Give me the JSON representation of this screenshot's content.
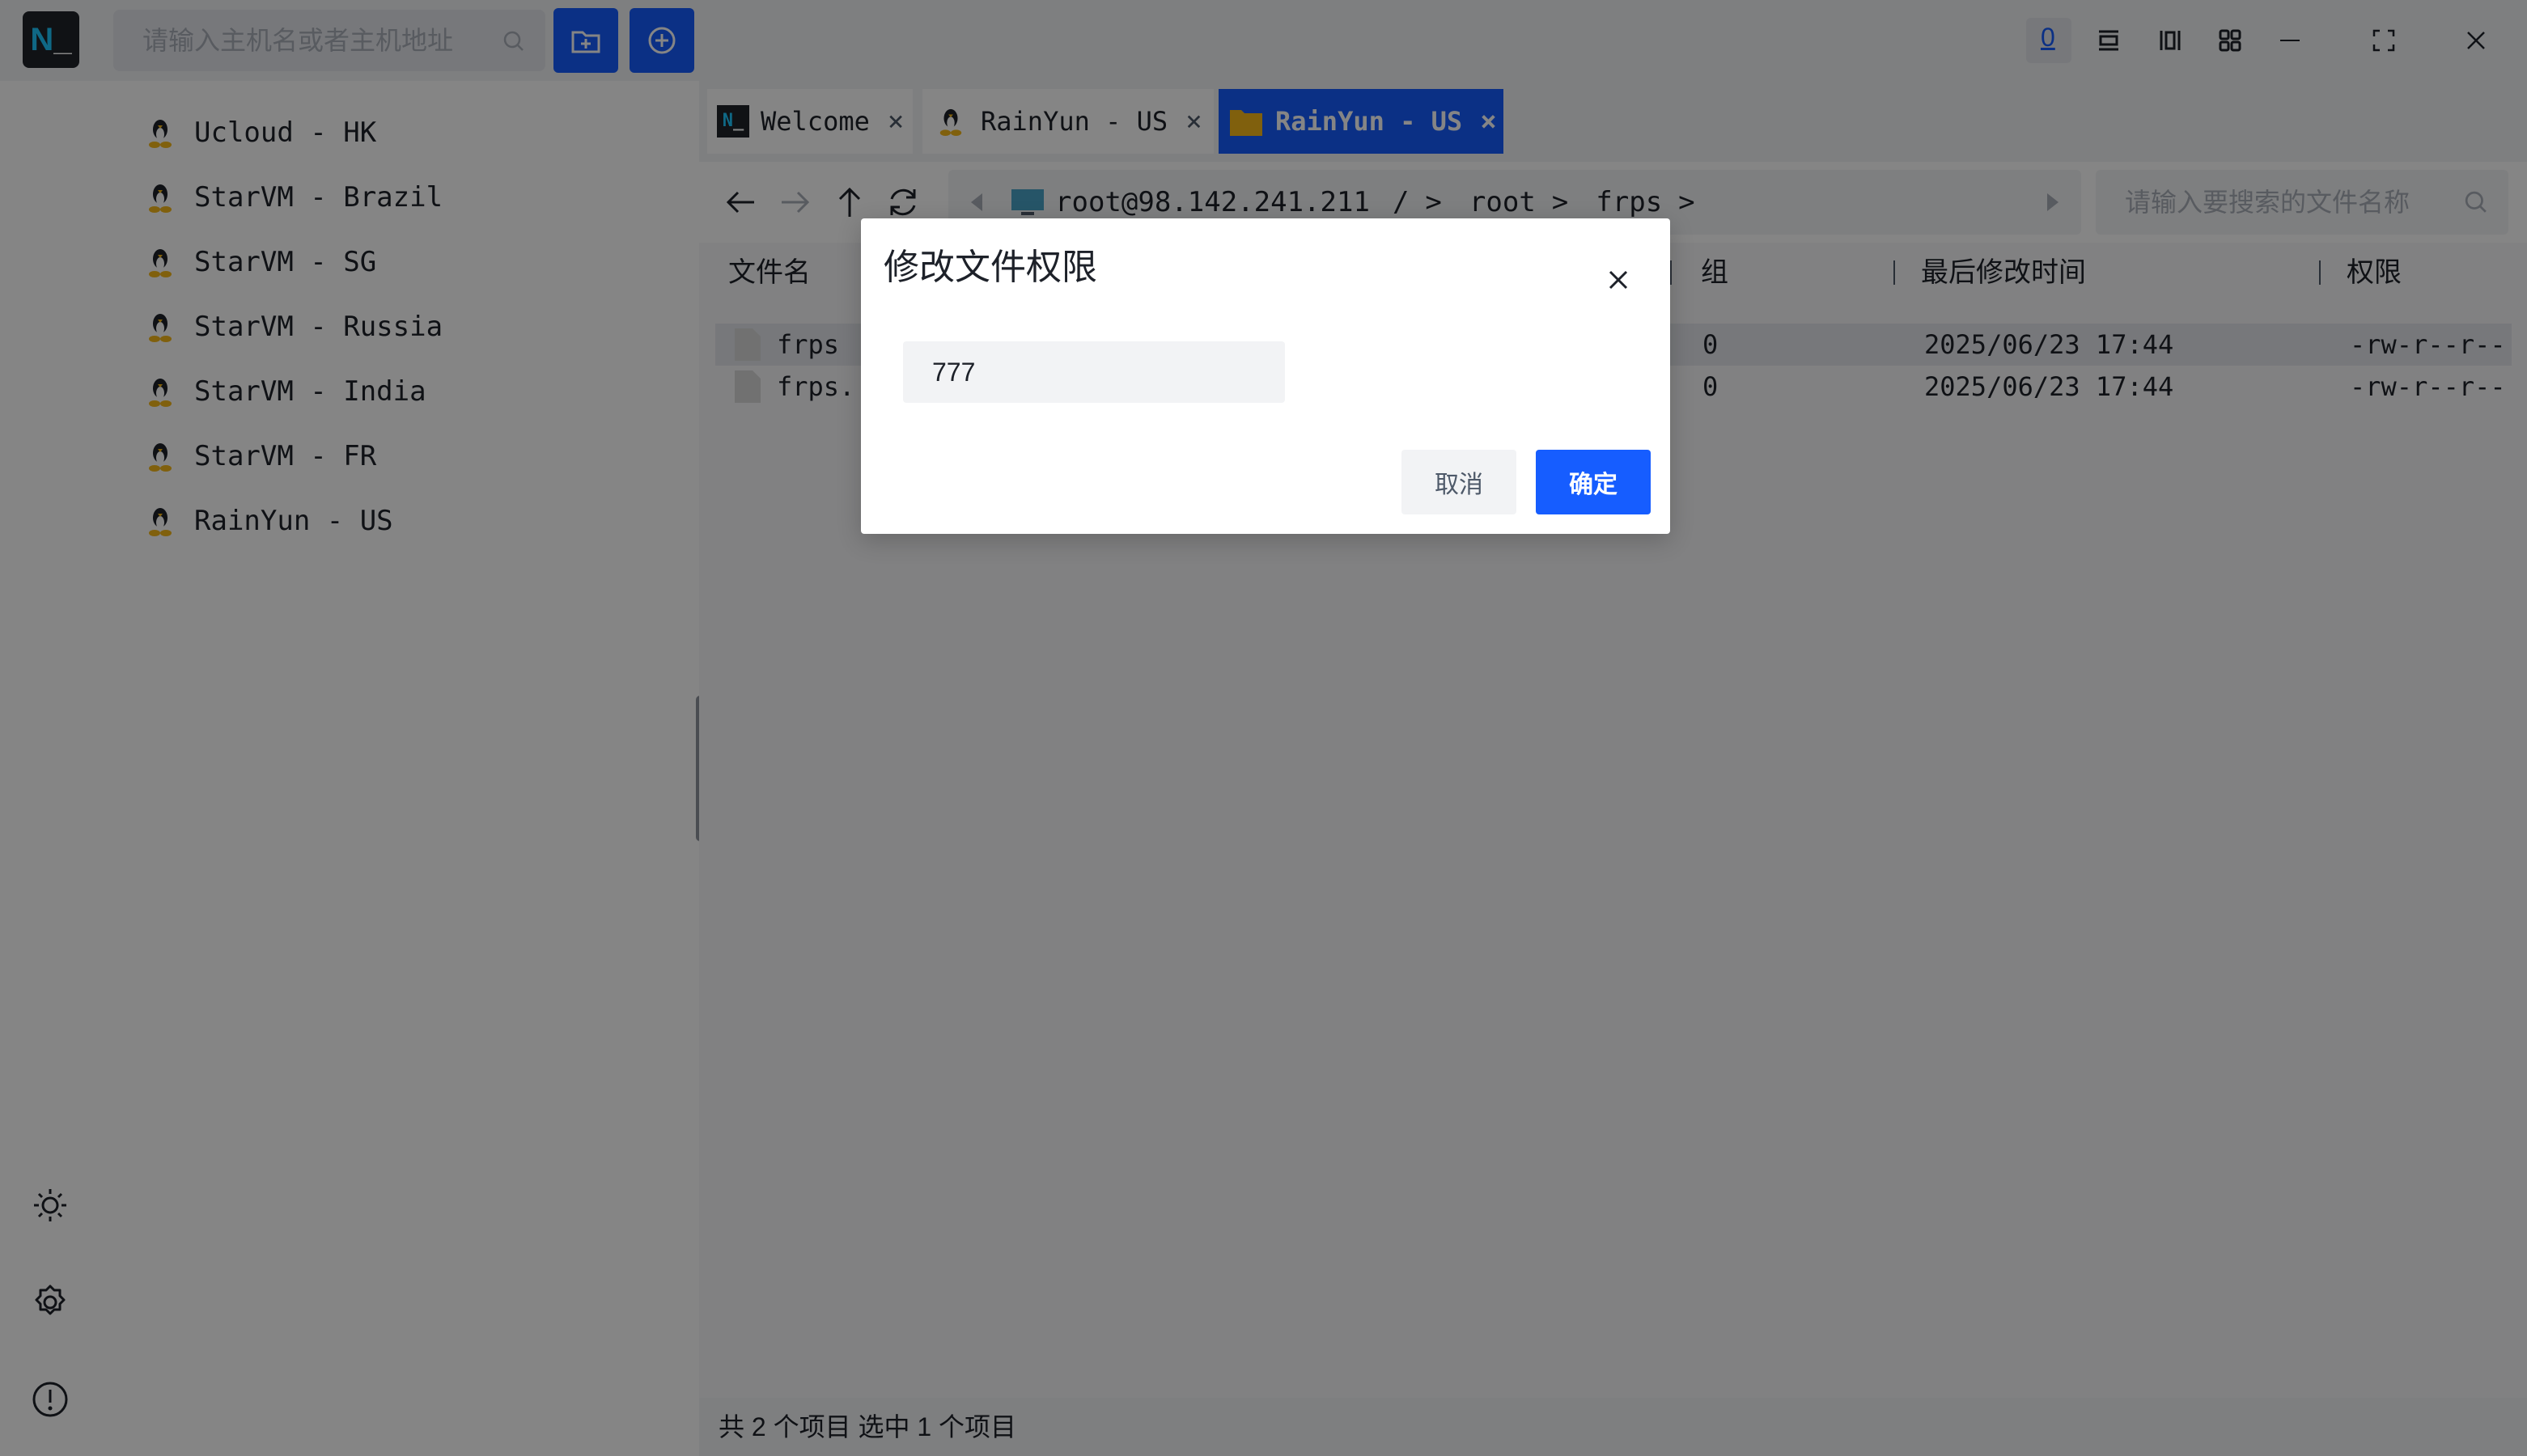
{
  "app": {
    "logo_text": "N",
    "logo_cursor": "_"
  },
  "topbar": {
    "host_search_placeholder": "请输入主机名或者主机地址",
    "active_badge": "0"
  },
  "sidebar": {
    "hosts": [
      {
        "label": "Ucloud - HK"
      },
      {
        "label": "StarVM - Brazil"
      },
      {
        "label": "StarVM - SG"
      },
      {
        "label": "StarVM - Russia"
      },
      {
        "label": "StarVM - India"
      },
      {
        "label": "StarVM - FR"
      },
      {
        "label": "RainYun - US"
      }
    ]
  },
  "tabs": [
    {
      "label": "Welcome",
      "close": "×"
    },
    {
      "label": "RainYun - US",
      "close": "×"
    },
    {
      "label": "RainYun - US",
      "close": "×"
    }
  ],
  "path": {
    "host": "root@98.142.241.211",
    "segments": [
      "/",
      "root",
      "frps"
    ],
    "separator": ">"
  },
  "file_search_placeholder": "请输入要搜索的文件名称",
  "columns": {
    "name": "文件名",
    "group": "组",
    "modified": "最后修改时间",
    "permissions": "权限"
  },
  "files": [
    {
      "name": "frps",
      "group": "0",
      "modified": "2025/06/23 17:44",
      "permissions": "-rw-r--r--"
    },
    {
      "name": "frps.",
      "group": "0",
      "modified": "2025/06/23 17:44",
      "permissions": "-rw-r--r--"
    }
  ],
  "statusbar": {
    "text": "共 2 个项目 选中 1 个项目"
  },
  "dialog": {
    "title": "修改文件权限",
    "input_value": "777",
    "cancel_label": "取消",
    "ok_label": "确定"
  },
  "colors": {
    "accent": "#165dff",
    "tab_folder": "#f5b819",
    "linux_penguin_body": "#1d2129",
    "linux_penguin_feet": "#f5b819"
  }
}
